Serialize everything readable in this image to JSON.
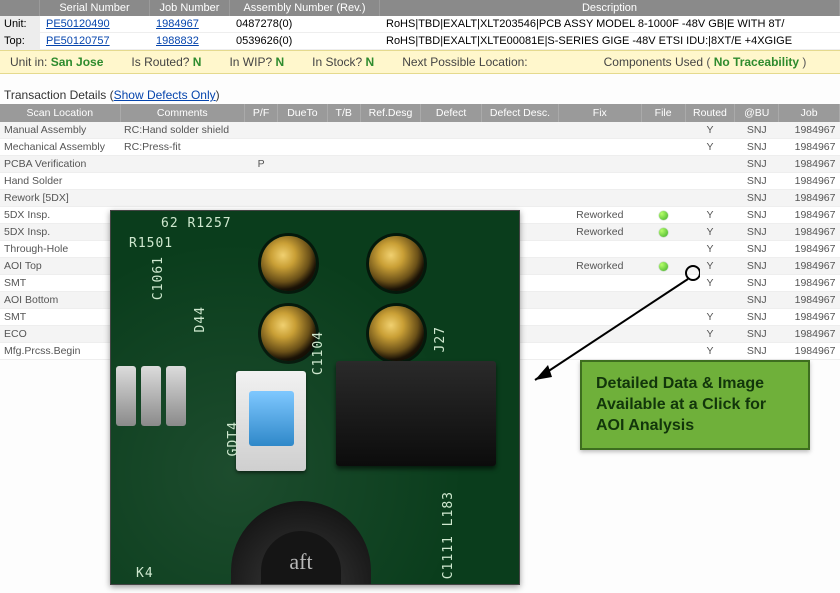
{
  "header": {
    "columns": {
      "serial": "Serial Number",
      "job": "Job Number",
      "assembly": "Assembly Number (Rev.)",
      "description": "Description"
    },
    "rows": [
      {
        "label": "Unit:",
        "serial": "PE50120490",
        "job": "1984967",
        "assembly": "0487278(0)",
        "description": "RoHS|TBD|EXALT|XLT203546|PCB ASSY MODEL 8-1000F -48V GB|E WITH 8T/"
      },
      {
        "label": "Top:",
        "serial": "PE50120757",
        "job": "1988832",
        "assembly": "0539626(0)",
        "description": "RoHS|TBD|EXALT|XLTE00081E|S-SERIES GIGE -48V ETSI IDU:|8XT/E +4XGIGE"
      }
    ]
  },
  "status": {
    "unit_in_label": "Unit in:",
    "unit_in_value": "San Jose",
    "routed_label": "Is Routed?",
    "routed_value": "N",
    "wip_label": "In WIP?",
    "wip_value": "N",
    "stock_label": "In Stock?",
    "stock_value": "N",
    "next_loc_label": "Next Possible Location:",
    "comp_used_label": "Components Used",
    "comp_used_paren_open": "(",
    "comp_used_value": "No Traceability",
    "comp_used_paren_close": ")"
  },
  "txn_title_prefix": "Transaction Details (",
  "txn_title_link": "Show Defects Only",
  "txn_title_suffix": ")",
  "grid": {
    "columns": {
      "scan": "Scan Location",
      "comments": "Comments",
      "pf": "P/F",
      "due": "DueTo",
      "tb": "T/B",
      "ref": "Ref.Desg",
      "defect": "Defect",
      "dd": "Defect Desc.",
      "fix": "Fix",
      "file": "File",
      "routed": "Routed",
      "bu": "@BU",
      "job": "Job"
    },
    "rows": [
      {
        "scan": "Manual Assembly",
        "comments": "RC:Hand solder shield",
        "pf": "",
        "fix": "",
        "file": "",
        "routed": "Y",
        "bu": "SNJ",
        "job": "1984967"
      },
      {
        "scan": "Mechanical Assembly",
        "comments": "RC:Press-fit",
        "pf": "",
        "fix": "",
        "file": "",
        "routed": "Y",
        "bu": "SNJ",
        "job": "1984967"
      },
      {
        "scan": "PCBA Verification",
        "comments": "",
        "pf": "P",
        "fix": "",
        "file": "",
        "routed": "",
        "bu": "SNJ",
        "job": "1984967"
      },
      {
        "scan": "Hand Solder",
        "comments": "",
        "pf": "",
        "fix": "",
        "file": "",
        "routed": "",
        "bu": "SNJ",
        "job": "1984967"
      },
      {
        "scan": "Rework [5DX]",
        "comments": "",
        "pf": "",
        "fix": "",
        "file": "",
        "routed": "",
        "bu": "SNJ",
        "job": "1984967"
      },
      {
        "scan": "5DX Insp.",
        "comments": "",
        "pf": "",
        "fix": "Reworked",
        "file": "dot",
        "routed": "Y",
        "bu": "SNJ",
        "job": "1984967"
      },
      {
        "scan": "5DX Insp.",
        "comments": "",
        "pf": "",
        "fix": "Reworked",
        "file": "dot",
        "routed": "Y",
        "bu": "SNJ",
        "job": "1984967"
      },
      {
        "scan": "Through-Hole",
        "comments": "",
        "pf": "",
        "fix": "",
        "file": "",
        "routed": "Y",
        "bu": "SNJ",
        "job": "1984967"
      },
      {
        "scan": "AOI Top",
        "comments": "",
        "pf": "",
        "fix": "Reworked",
        "file": "dot",
        "routed": "Y",
        "bu": "SNJ",
        "job": "1984967"
      },
      {
        "scan": "SMT",
        "comments": "",
        "pf": "",
        "fix": "",
        "file": "",
        "routed": "Y",
        "bu": "SNJ",
        "job": "1984967"
      },
      {
        "scan": "AOI Bottom",
        "comments": "",
        "pf": "",
        "fix": "",
        "file": "",
        "routed": "",
        "bu": "SNJ",
        "job": "1984967"
      },
      {
        "scan": "SMT",
        "comments": "",
        "pf": "",
        "fix": "",
        "file": "",
        "routed": "Y",
        "bu": "SNJ",
        "job": "1984967"
      },
      {
        "scan": "ECO",
        "comments": "",
        "pf": "",
        "fix": "",
        "file": "",
        "routed": "Y",
        "bu": "SNJ",
        "job": "1984967"
      },
      {
        "scan": "Mfg.Prcss.Begin",
        "comments": "",
        "pf": "",
        "fix": "",
        "file": "",
        "routed": "Y",
        "bu": "SNJ",
        "job": "1984967"
      }
    ]
  },
  "callout": {
    "text": "Detailed Data & Image Available at a Click for AOI Analysis"
  },
  "pcb_silk": {
    "a": "62 R1257",
    "b": "C1061",
    "c": "D44",
    "d": "C1104",
    "e": "J27",
    "f": "GDT4",
    "g": "C1111 L183",
    "h": "K4",
    "i": "R1501"
  }
}
